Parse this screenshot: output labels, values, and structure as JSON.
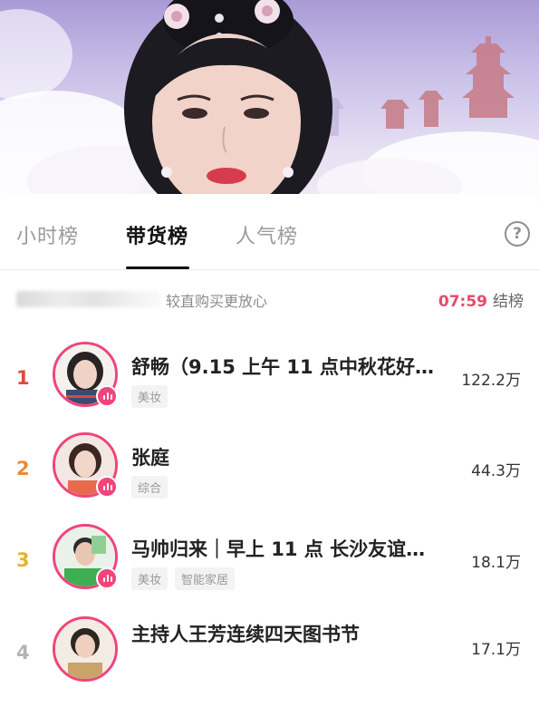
{
  "tabs": [
    {
      "label": "小时榜",
      "active": false
    },
    {
      "label": "带货榜",
      "active": true
    },
    {
      "label": "人气榜",
      "active": false
    }
  ],
  "help_icon": "question-circle-icon",
  "notice": {
    "text": "较直购买更放心",
    "timer": "07:59",
    "timer_suffix": "结榜"
  },
  "ranking": [
    {
      "rank": "1",
      "name": "舒畅（9.15 上午 11 点中秋花好…",
      "tags": [
        "美妆"
      ],
      "value": "122.2万"
    },
    {
      "rank": "2",
      "name": "张庭",
      "tags": [
        "综合"
      ],
      "value": "44.3万"
    },
    {
      "rank": "3",
      "name": "马帅归来｜早上 11 点 长沙友谊…",
      "tags": [
        "美妆",
        "智能家居"
      ],
      "value": "18.1万"
    },
    {
      "rank": "4",
      "name": "主持人王芳连续四天图书节",
      "tags": [],
      "value": "17.1万"
    }
  ],
  "colors": {
    "accent": "#f0447a",
    "timer": "#e64a6a",
    "rank1": "#e2473f",
    "rank2": "#e88a36",
    "rank3": "#e2b626"
  }
}
